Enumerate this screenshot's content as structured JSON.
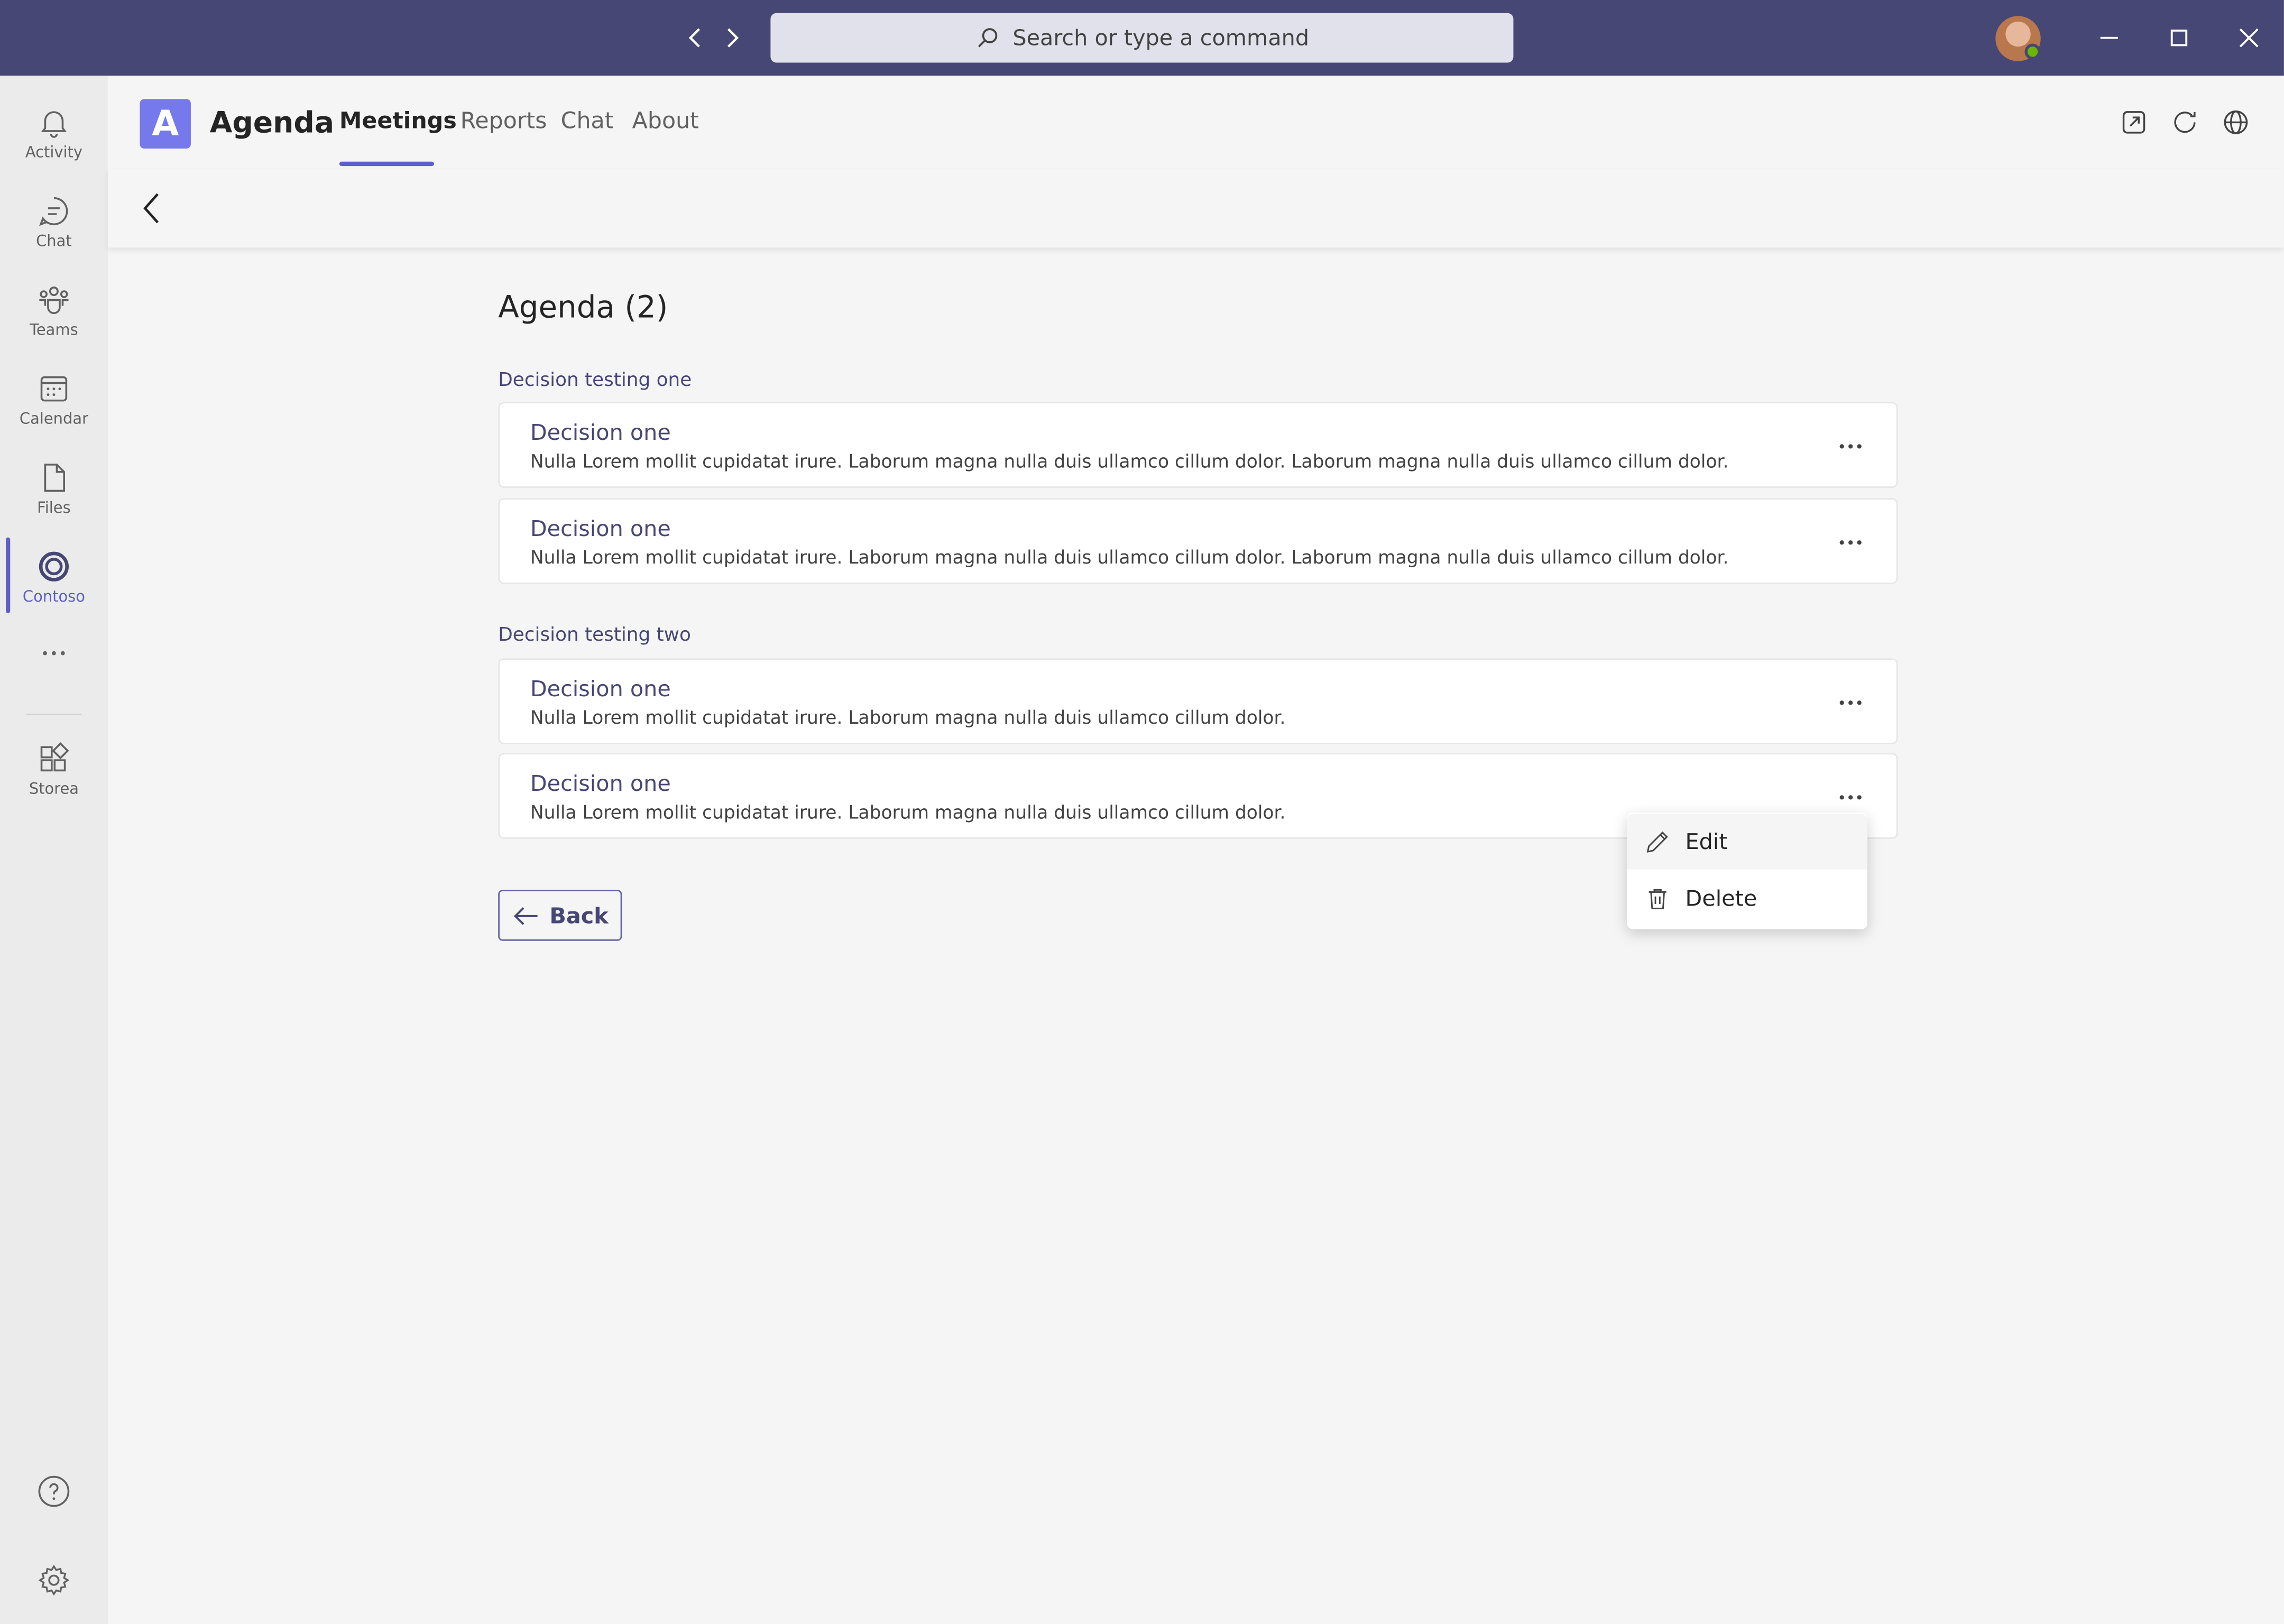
{
  "titlebar": {
    "search_placeholder": "Search or type a command"
  },
  "rail": {
    "items": [
      {
        "label": "Activity",
        "icon": "bell-icon"
      },
      {
        "label": "Chat",
        "icon": "chat-icon"
      },
      {
        "label": "Teams",
        "icon": "teams-icon"
      },
      {
        "label": "Calendar",
        "icon": "calendar-icon"
      },
      {
        "label": "Files",
        "icon": "file-icon"
      },
      {
        "label": "Contoso",
        "icon": "contoso-icon",
        "active": true
      },
      {
        "label": "Storea",
        "icon": "store-icon"
      }
    ]
  },
  "app": {
    "logo_letter": "A",
    "name": "Agenda",
    "tabs": [
      "Meetings",
      "Reports",
      "Chat",
      "About"
    ],
    "active_tab": "Meetings"
  },
  "page": {
    "title": "Agenda (2)",
    "sections": [
      {
        "label": "Decision testing one",
        "items": [
          {
            "title": "Decision one",
            "description": "Nulla Lorem mollit cupidatat irure. Laborum magna nulla duis ullamco cillum dolor. Laborum magna nulla duis ullamco cillum dolor."
          },
          {
            "title": "Decision one",
            "description": "Nulla Lorem mollit cupidatat irure. Laborum magna nulla duis ullamco cillum dolor. Laborum magna nulla duis ullamco cillum dolor."
          }
        ]
      },
      {
        "label": "Decision testing two",
        "items": [
          {
            "title": "Decision one",
            "description": "Nulla Lorem mollit cupidatat irure. Laborum magna nulla duis ullamco cillum dolor."
          },
          {
            "title": "Decision one",
            "description": "Nulla Lorem mollit cupidatat irure. Laborum magna nulla duis ullamco cillum dolor."
          }
        ]
      }
    ],
    "back_label": "Back"
  },
  "context_menu": {
    "items": [
      "Edit",
      "Delete"
    ]
  },
  "colors": {
    "titlebar": "#464775",
    "accent": "#5b5fc7",
    "app_logo": "#7579eb",
    "presence": "#6bb700"
  }
}
